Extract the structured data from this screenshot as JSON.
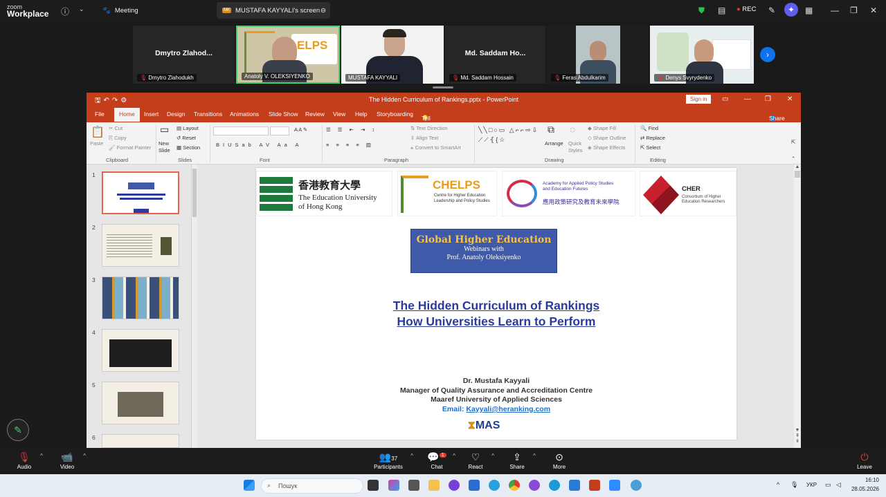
{
  "zoom": {
    "logo_top": "zoom",
    "logo_bottom": "Workplace",
    "meeting_label": "Meeting",
    "share_tab": "MUSTAFA KAYYALI's screen",
    "rec": "REC",
    "leaveLabel": "Leave"
  },
  "participants": [
    {
      "name": "Dmytro Zlahod...",
      "label": "Dmytro Zlahodukh"
    },
    {
      "name": "Anatoly V. OLEKSIYENKO",
      "label": "Anatoly V. OLEKSIYENKO"
    },
    {
      "name": "MUSTAFA KAYYALI",
      "label": "MUSTAFA KAYYALI"
    },
    {
      "name": "Md. Saddam Ho...",
      "label": "Md. Saddam Hossain"
    },
    {
      "name": "Feras Abdulkarim",
      "label": "Feras Abdulkarim"
    },
    {
      "name": "Denys Svyrydenko",
      "label": "Denys Svyrydenko"
    }
  ],
  "ppt": {
    "window_title": "The Hidden Curriculum of Rankings.pptx  -  PowerPoint",
    "signin": "Sign in",
    "tabs": [
      "File",
      "Home",
      "Insert",
      "Design",
      "Transitions",
      "Animations",
      "Slide Show",
      "Review",
      "View",
      "Help",
      "Storyboarding"
    ],
    "tellme": "Tell me what you want to do",
    "share": "Share",
    "ribbon": {
      "paste": "Paste",
      "cut": "Cut",
      "copy": "Copy",
      "format_painter": "Format Painter",
      "clipboard": "Clipboard",
      "new_slide": "New Slide",
      "layout": "Layout",
      "reset": "Reset",
      "section": "Section",
      "slides": "Slides",
      "font": "Font",
      "paragraph": "Paragraph",
      "text_direction": "Text Direction",
      "align_text": "Align Text",
      "convert_smartart": "Convert to SmartArt",
      "arrange": "Arrange",
      "quick_styles": "Quick Styles",
      "shape_fill": "Shape Fill",
      "shape_outline": "Shape Outline",
      "shape_effects": "Shape Effects",
      "drawing": "Drawing",
      "find": "Find",
      "replace": "Replace",
      "select": "Select",
      "editing": "Editing"
    },
    "slide_numbers": [
      "1",
      "2",
      "3",
      "4",
      "5",
      "6"
    ],
    "slide": {
      "eduhk_cn": "香港教育大學",
      "eduhk_en1": "The Education University",
      "eduhk_en2": "of Hong Kong",
      "chelps": "CHELPS",
      "chelps_sub1": "Centre for Higher Education",
      "chelps_sub2": "Leadership and Policy Studies",
      "academy1": "Academy for Applied Policy Studies",
      "academy2": "and Education Futures",
      "academy_cn": "應用政策研究及教育未來學院",
      "cher": "CHER",
      "cher_sub1": "Consortium of Higher",
      "cher_sub2": "Education Researchers",
      "banner_l1": "Global Higher Education",
      "banner_l2": "Webinars with",
      "banner_l3": "Prof. Anatoly Oleksiyenko",
      "title1": "The Hidden Curriculum of Rankings",
      "title2": "How Universities Learn to Perform",
      "presenter": "Dr. Mustafa Kayyali",
      "role": "Manager of Quality Assurance and Accreditation Centre",
      "university": "Maaref University of Applied Sciences",
      "email_label": "Email:",
      "email": "Kayyali@heranking.com",
      "mas": "MAS"
    }
  },
  "controls": {
    "audio": "Audio",
    "video": "Video",
    "participants": "Participants",
    "participant_count": "37",
    "chat": "Chat",
    "chat_badge": "1",
    "react": "React",
    "share": "Share",
    "more": "More",
    "leave": "Leave"
  },
  "taskbar": {
    "search": "Пошук",
    "lang": "УКР",
    "time": "16:10",
    "date": "28.05.2026"
  }
}
